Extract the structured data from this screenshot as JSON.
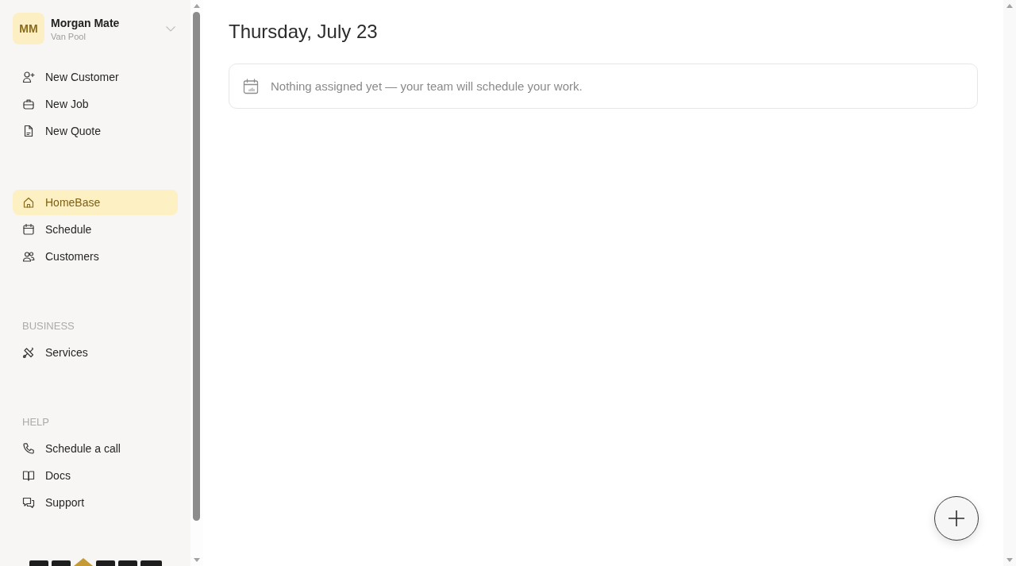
{
  "sidebar": {
    "account": {
      "initials": "MM",
      "name": "Morgan Mate",
      "team": "Van Pool"
    },
    "quick_actions": [
      {
        "label": "New Customer"
      },
      {
        "label": "New Job"
      },
      {
        "label": "New Quote"
      }
    ],
    "nav": [
      {
        "label": "HomeBase",
        "selected": true
      },
      {
        "label": "Schedule",
        "selected": false
      },
      {
        "label": "Customers",
        "selected": false
      }
    ],
    "sections": [
      {
        "heading": "BUSINESS",
        "items": [
          {
            "label": "Services",
            "selected": false
          }
        ]
      },
      {
        "heading": "HELP",
        "items": [
          {
            "label": "Schedule a call"
          },
          {
            "label": "Docs"
          },
          {
            "label": "Support"
          }
        ]
      }
    ]
  },
  "main": {
    "title": "Thursday, July 23",
    "empty_message": "Nothing assigned yet — your team will schedule your work."
  }
}
